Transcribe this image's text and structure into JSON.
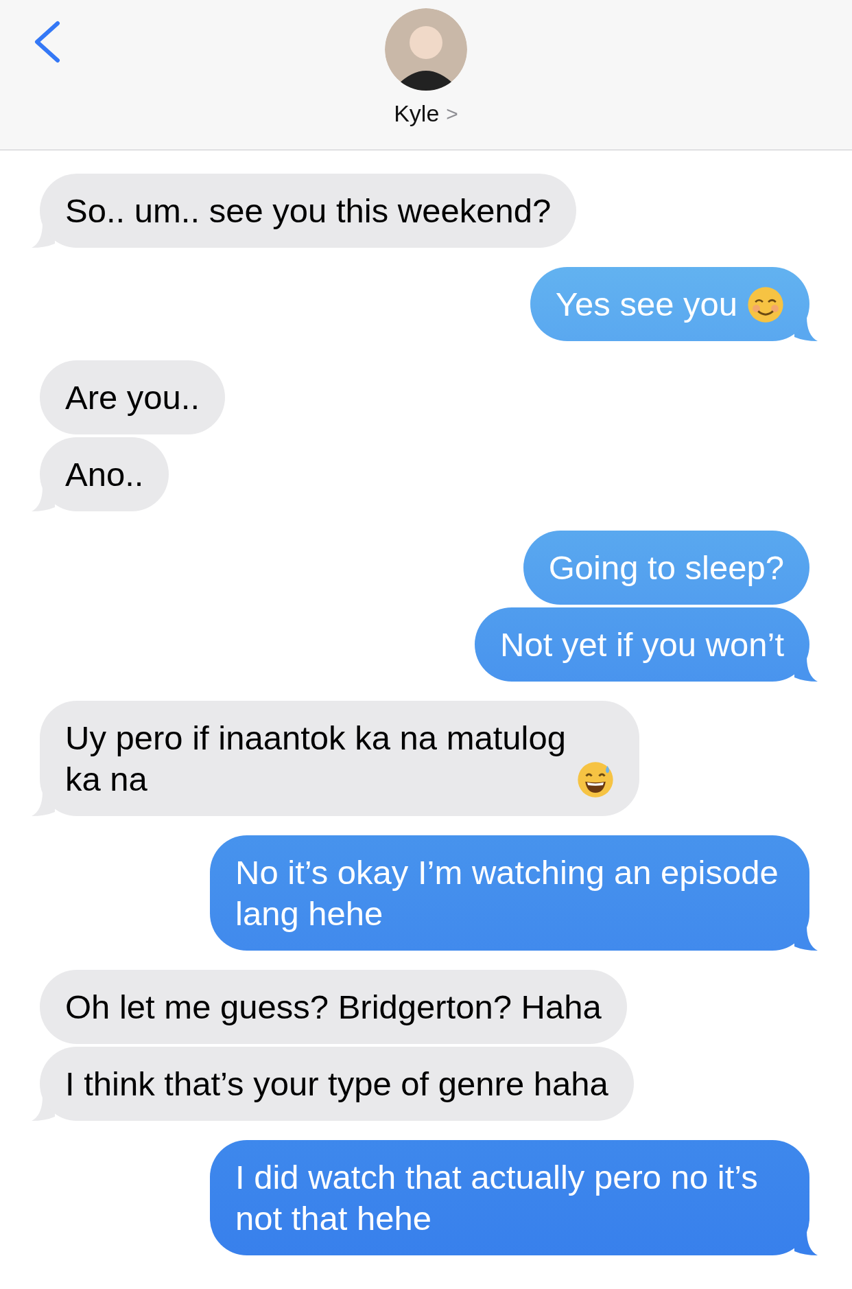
{
  "header": {
    "contact_name": "Kyle",
    "chevron": ">"
  },
  "messages": [
    {
      "kind": "incoming",
      "text": "So.. um.. see you this weekend?",
      "tail": true
    },
    {
      "kind": "outgoing",
      "text": "Yes see you",
      "emoji": {
        "kind": "blush"
      },
      "tail": true
    },
    {
      "kind": "incoming",
      "text": "Are you..",
      "tail": false
    },
    {
      "kind": "incoming",
      "text": "Ano..",
      "tail": true
    },
    {
      "kind": "outgoing",
      "text": "Going to sleep?",
      "tail": false
    },
    {
      "kind": "outgoing",
      "text": "Not yet if you won’t",
      "tail": true
    },
    {
      "kind": "incoming",
      "text": "Uy pero if inaantok ka na matulog ka na",
      "emoji": {
        "kind": "sweat_smile"
      },
      "tail": true
    },
    {
      "kind": "outgoing",
      "text": "No it’s okay I’m watching an episode lang hehe",
      "tail": true
    },
    {
      "kind": "incoming",
      "text": "Oh let me guess? Bridgerton? Haha",
      "tail": false
    },
    {
      "kind": "incoming",
      "text": "I think that’s your type of genre haha",
      "tail": true
    },
    {
      "kind": "outgoing",
      "text": "I did watch that actually pero no it’s not that hehe",
      "tail": true
    }
  ]
}
